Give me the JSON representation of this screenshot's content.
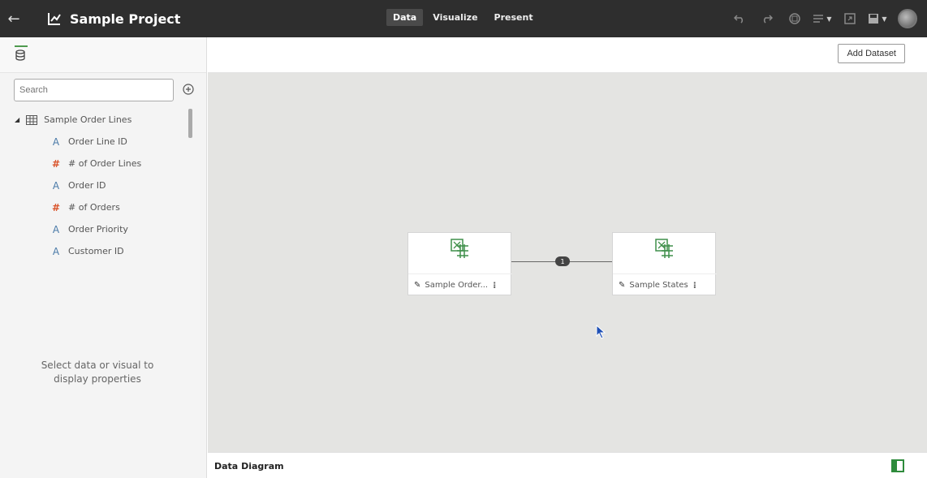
{
  "header": {
    "back_icon": "back-arrow-icon",
    "project_icon": "chart-icon",
    "project_title": "Sample Project",
    "tabs": [
      {
        "label": "Data",
        "active": true
      },
      {
        "label": "Visualize",
        "active": false
      },
      {
        "label": "Present",
        "active": false
      }
    ],
    "tools": [
      "undo-icon",
      "redo-icon",
      "refresh-icon",
      "menu-icon",
      "export-icon",
      "save-icon",
      "avatar-icon"
    ]
  },
  "left_panel": {
    "tab_icon": "database-icon",
    "search_placeholder": "Search",
    "add_icon": "add-circle-icon",
    "dataset": {
      "name": "Sample Order Lines",
      "expanded": true,
      "columns": [
        {
          "name": "Order Line ID",
          "type": "attribute",
          "symbol": "A"
        },
        {
          "name": "# of Order Lines",
          "type": "measure",
          "symbol": "#"
        },
        {
          "name": "Order ID",
          "type": "attribute",
          "symbol": "A"
        },
        {
          "name": "# of Orders",
          "type": "measure",
          "symbol": "#"
        },
        {
          "name": "Order Priority",
          "type": "attribute",
          "symbol": "A"
        },
        {
          "name": "Customer ID",
          "type": "attribute",
          "symbol": "A"
        }
      ]
    },
    "properties_message": "Select data or visual to display properties"
  },
  "toolbar": {
    "add_dataset_label": "Add Dataset"
  },
  "diagram": {
    "nodes": [
      {
        "label": "Sample Order...",
        "kebab": "⁝"
      },
      {
        "label": "Sample States",
        "kebab": "⁝"
      }
    ],
    "link_count": "1"
  },
  "footer": {
    "title": "Data Diagram"
  },
  "colors": {
    "topbar": "#2e2e2e",
    "canvas": "#e4e4e2",
    "accent_green": "#2e8b3c",
    "measure_orange": "#d9542b",
    "attribute_blue": "#4a7aa8"
  }
}
